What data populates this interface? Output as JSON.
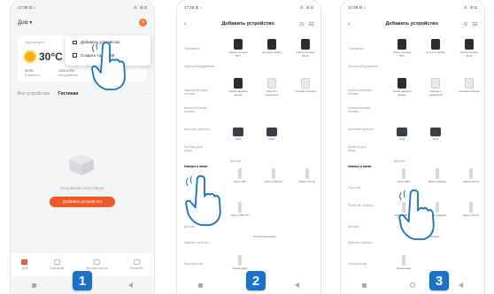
{
  "phone1": {
    "status_time": "17:48 ⊡ ⌂",
    "status_right": "⁂ ˙ıll ⊡",
    "home_title": "Дом ▾",
    "plus": "+",
    "weather_temp": "30°C",
    "weather_label": "Удачный день",
    "weather_hum": "50.6%",
    "weather_hum_lbl": "Влажность",
    "weather_pres": "1020.3 hPa",
    "weather_pres_lbl": "атм.давление",
    "menu_add": "Добавить устройство",
    "menu_scene": "Создать сценарий",
    "tab_all": "Все устройства",
    "tab_living": "Гостиная",
    "tab_more": "···",
    "empty_text": "Устройства отсутствуют",
    "add_button": "Добавить устройство",
    "bottom_tabs": [
      "Дом",
      "Сценарии",
      "Автоматизация",
      "Профиль"
    ],
    "badge": "1"
  },
  "phone2": {
    "status_time": "17:49 ⊡ ⌂",
    "status_right": "⁂ ˙ıll ⊡",
    "back": "‹",
    "title": "Добавить устройство",
    "header_icons": "⊙ ⊟",
    "categories": [
      "Освещение",
      "Электрооборудование",
      "Крупная бытовая техника",
      "Мелкая бытовая техника",
      "Кухонные приборы",
      "Приборы для ухода",
      "Камеры и замки",
      "Датчики",
      "Крупные приборы",
      "Портатив.",
      "Портатив.\nприборы",
      "Пространство"
    ],
    "devices_row1": [
      "Умная колонка (BT)",
      "Сетевой тамбур",
      "Умная колонка (BLE)"
    ],
    "devices_row2": [
      "Умная дверная звонок",
      "Камера с подсветкой",
      "Сетевая станция"
    ],
    "devices_row3": [
      "DVR",
      "NVR"
    ],
    "mid_label": "Датчики",
    "switch_row": [
      "Замок (BT)",
      "Замок (Zigbee)",
      "Замок (Wi-Fi)"
    ],
    "switch_row2": [
      "Замок (NB-IoT)"
    ],
    "cloud_label": "Блокировка видео",
    "bottom_dev": "Блокировка",
    "badge": "2"
  },
  "phone3": {
    "status_time": "17:49 ⊡ ⌂",
    "status_right": "⁂ ˙ıll ⊡",
    "back": "‹",
    "title": "Добавить устройство",
    "header_icons": "⊙ ⊟",
    "badge": "3"
  }
}
